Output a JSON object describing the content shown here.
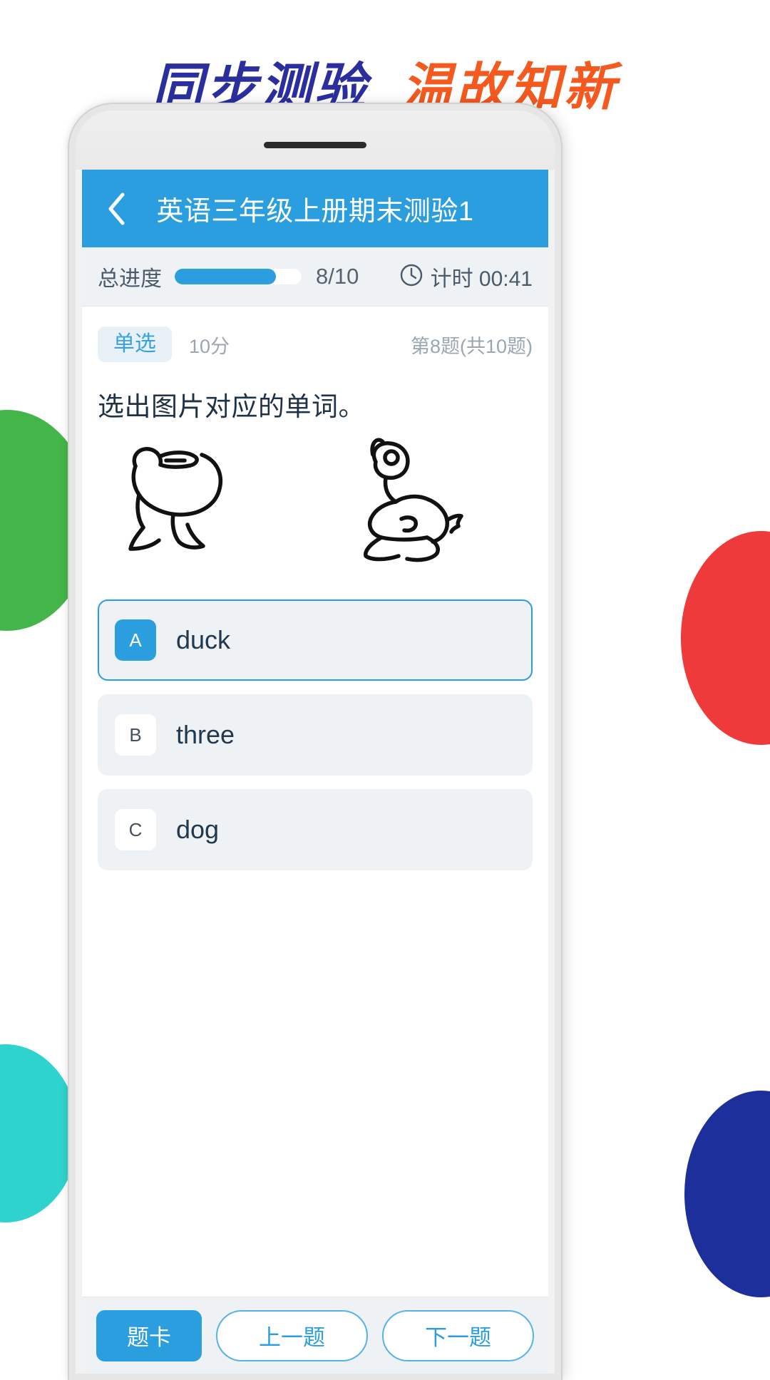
{
  "promo": {
    "headline_blue": "同步测验",
    "headline_orange": "温故知新",
    "color_blue": "#2b2f9e",
    "color_orange": "#f4591f"
  },
  "decor": {
    "circle_green": "#44b649",
    "circle_teal": "#2fd3cd",
    "circle_red": "#ee3a3a",
    "circle_navy": "#1d2f9b"
  },
  "app": {
    "accent": "#2b9ee0",
    "header": {
      "back_icon": "chevron-left-icon",
      "title": "英语三年级上册期末测验1"
    },
    "progress": {
      "label": "总进度",
      "percent": 80,
      "count": "8/10",
      "timer_icon": "clock-icon",
      "timer_text": "计时 00:41"
    },
    "question": {
      "type_badge": "单选",
      "score": "10分",
      "index": "第8题(共10题)",
      "text": "选出图片对应的单词。",
      "image_alt": "two-ducks-line-drawing",
      "options": [
        {
          "letter": "A",
          "text": "duck",
          "selected": true
        },
        {
          "letter": "B",
          "text": "three",
          "selected": false
        },
        {
          "letter": "C",
          "text": "dog",
          "selected": false
        }
      ]
    },
    "bottom": {
      "card_label": "题卡",
      "prev_label": "上一题",
      "next_label": "下一题"
    }
  }
}
